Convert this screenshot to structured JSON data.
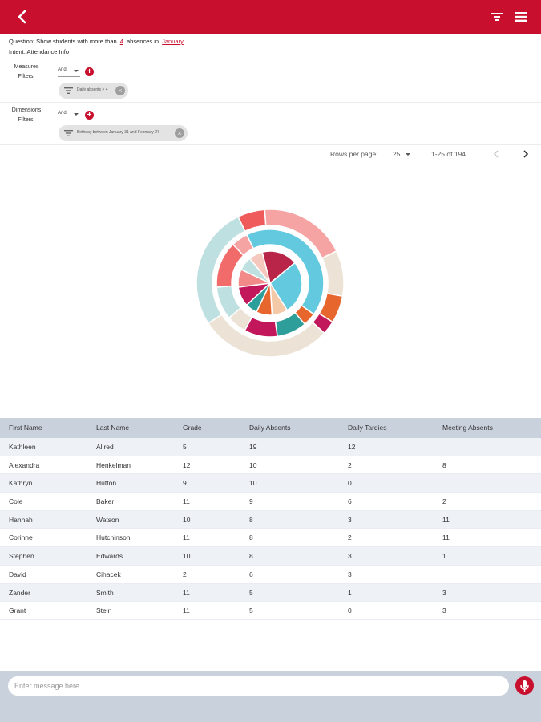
{
  "colors": {
    "brand": "#c8102e",
    "chip_bg": "#e3e3e3",
    "table_header": "#c9d1dc"
  },
  "appbar": {
    "back_icon": "arrow-left-icon",
    "filter_icon": "filter-icon",
    "menu_icon": "menu-icon"
  },
  "question": {
    "prefix": "Question: Show students with more than",
    "count": "4",
    "middle": "absences in",
    "month": "January"
  },
  "intent": "Intent: Attendance Info",
  "measures": {
    "label": "Measures Filters:",
    "operator": "And",
    "chip": "Daily absents > 4"
  },
  "dimensions": {
    "label": "Dimensions Filters:",
    "operator": "And",
    "chip": "Birthday between January 31 and February 27"
  },
  "pager": {
    "rows_label": "Rows per page:",
    "rows_value": "25",
    "range": "1-25 of 194"
  },
  "chart_data": {
    "type": "sunburst",
    "title": "",
    "note": "Three-ring sunburst of attendance data; slice values are approximate proportions (percent of ring).",
    "inner_ring": [
      {
        "value": 18,
        "color": "#b82548"
      },
      {
        "value": 27,
        "color": "#62c9de"
      },
      {
        "value": 8,
        "color": "#f4c9a8"
      },
      {
        "value": 8,
        "color": "#e7662e"
      },
      {
        "value": 6,
        "color": "#2e9e9a"
      },
      {
        "value": 10,
        "color": "#c2185b"
      },
      {
        "value": 9,
        "color": "#f28a8a"
      },
      {
        "value": 7,
        "color": "#bfe0e0"
      },
      {
        "value": 7,
        "color": "#f5c8bd"
      }
    ],
    "middle_ring": [
      {
        "value": 42,
        "color": "#62c9de"
      },
      {
        "value": 4,
        "color": "#e7662e"
      },
      {
        "value": 9,
        "color": "#2e9e9a"
      },
      {
        "value": 10,
        "color": "#c2185b"
      },
      {
        "value": 6,
        "color": "#ece3d6"
      },
      {
        "value": 10,
        "color": "#bfe0e0"
      },
      {
        "value": 14,
        "color": "#f26b6b"
      },
      {
        "value": 5,
        "color": "#f5a3a3"
      }
    ],
    "outer_ring": [
      {
        "value": 6,
        "color": "#ef5a5a"
      },
      {
        "value": 19,
        "color": "#f5a3a3"
      },
      {
        "value": 10,
        "color": "#ece3d6"
      },
      {
        "value": 6,
        "color": "#e7662e"
      },
      {
        "value": 3,
        "color": "#c2185b"
      },
      {
        "value": 29,
        "color": "#ece3d6"
      },
      {
        "value": 27,
        "color": "#bfe0e0"
      }
    ]
  },
  "table": {
    "headers": [
      "First Name",
      "Last Name",
      "Grade",
      "Daily Absents",
      "Daily Tardies",
      "Meeting Absents"
    ],
    "rows": [
      [
        "Kathleen",
        "Allred",
        "5",
        "19",
        "12",
        ""
      ],
      [
        "Alexandra",
        "Henkelman",
        "12",
        "10",
        "2",
        "8"
      ],
      [
        "Kathryn",
        "Hutton",
        "9",
        "10",
        "0",
        ""
      ],
      [
        "Cole",
        "Baker",
        "11",
        "9",
        "6",
        "2"
      ],
      [
        "Hannah",
        "Watson",
        "10",
        "8",
        "3",
        "11"
      ],
      [
        "Corinne",
        "Hutchinson",
        "11",
        "8",
        "2",
        "11"
      ],
      [
        "Stephen",
        "Edwards",
        "10",
        "8",
        "3",
        "1"
      ],
      [
        "David",
        "Cihacek",
        "2",
        "6",
        "3",
        ""
      ],
      [
        "Zander",
        "Smith",
        "11",
        "5",
        "1",
        "3"
      ],
      [
        "Grant",
        "Stein",
        "11",
        "5",
        "0",
        "3"
      ]
    ]
  },
  "composer": {
    "placeholder": "Enter message here...",
    "mic_icon": "microphone-icon"
  }
}
